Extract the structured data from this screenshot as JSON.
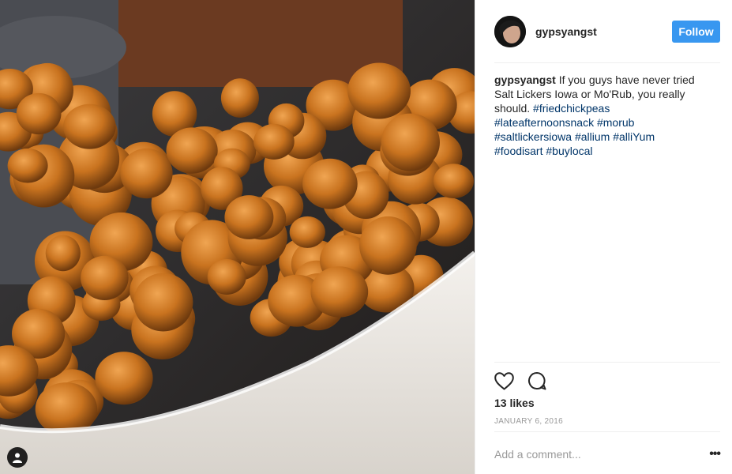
{
  "post": {
    "username": "gypsyangst",
    "follow_label": "Follow",
    "caption": {
      "username": "gypsyangst",
      "text": " If you guys have never tried Salt Lickers Iowa or Mo'Rub, you really should. ",
      "hashtags": [
        "#friedchickpeas",
        "#lateafternoonsnack",
        "#morub",
        "#saltlickersiowa",
        "#allium",
        "#alliYum",
        "#foodisart",
        "#buylocal"
      ]
    },
    "likes": "13 likes",
    "date": "JANUARY 6, 2016",
    "comment_placeholder": "Add a comment...",
    "more_label": "•••"
  },
  "icons": {
    "like": "heart-icon",
    "comment": "comment-bubble-icon",
    "tagged": "person-icon",
    "more": "more-options-icon"
  },
  "colors": {
    "follow_button": "#3897f0",
    "hashtag": "#003569",
    "muted_text": "#999999",
    "divider": "#efefef"
  }
}
